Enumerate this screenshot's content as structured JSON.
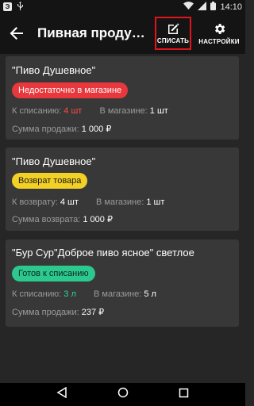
{
  "status_bar": {
    "time": "14:10",
    "icons": [
      "app-icon",
      "usb-icon",
      "wifi-icon",
      "signal-icon",
      "battery-icon"
    ]
  },
  "toolbar": {
    "title": "Пивная продукция",
    "write_off_label": "СПИСАТЬ",
    "settings_label": "НАСТРОЙКИ",
    "highlight_color": "#e0151c"
  },
  "cards": [
    {
      "title": "\"Пиво Душевное\"",
      "badge": {
        "text": "Недостаточно в магазине",
        "bg": "#e8383d",
        "fg": "#ffffff"
      },
      "qty_label": "К списанию:",
      "qty_value": "4 шт",
      "store_label": "В магазине:",
      "store_value": "1 шт",
      "sum_label": "Сумма продажи:",
      "sum_value": "1 000 ₽"
    },
    {
      "title": "\"Пиво Душевное\"",
      "badge": {
        "text": "Возврат товара",
        "bg": "#f2d025",
        "fg": "#1a1a1a"
      },
      "qty_label": "К возврату:",
      "qty_value": "4 шт",
      "store_label": "В магазине:",
      "store_value": "1 шт",
      "sum_label": "Сумма возврата:",
      "sum_value": "1 000 ₽"
    },
    {
      "title": "\"Бур Сур\"Доброе пиво ясное\" светлое",
      "badge": {
        "text": "Готов к списанию",
        "bg": "#2cc98f",
        "fg": "#10221b"
      },
      "qty_label": "К списанию:",
      "qty_value": "3 л",
      "store_label": "В магазине:",
      "store_value": "5 л",
      "sum_label": "Сумма продажи:",
      "sum_value": "237 ₽"
    }
  ]
}
